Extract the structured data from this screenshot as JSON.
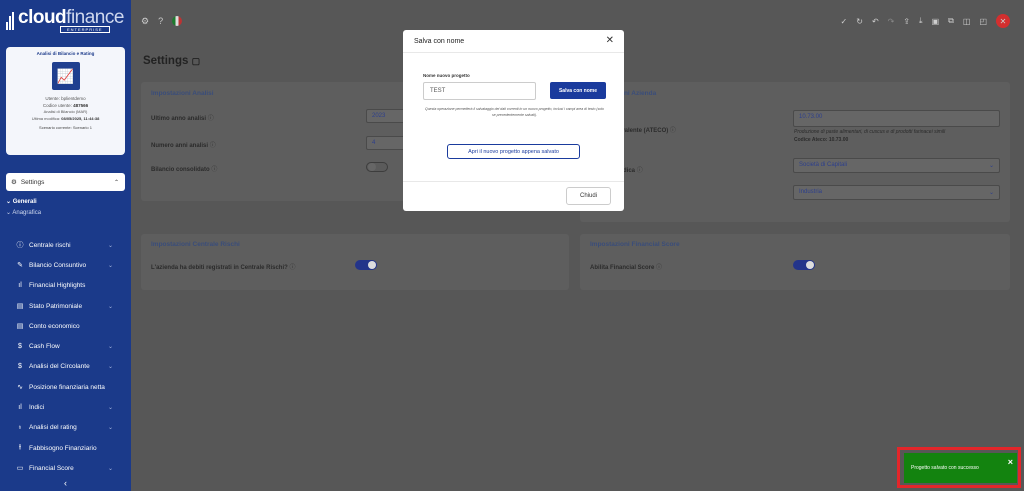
{
  "brand": {
    "logo_a": "cloud",
    "logo_b": "finance",
    "edition": "ENTERPRISE"
  },
  "card": {
    "title": "Analisi di Bilancio e Rating",
    "user_label": "Utente:",
    "user": "bplientdemo",
    "code_label": "Codice utente:",
    "code": "487566",
    "type": "Analisi di Bilancio (MAR)",
    "modified_label": "Ultima modifica:",
    "modified": "08/05/2025, 11:44:38",
    "scenario": "Scenario corrente: Scenario 1"
  },
  "nav": {
    "settings": "Settings",
    "sub": [
      "Generali",
      "Anagrafica"
    ],
    "items": [
      {
        "label": "Centrale rischi",
        "icon": "info-icon",
        "chev": true,
        "ch": "ⓘ"
      },
      {
        "label": "Bilancio Consuntivo",
        "icon": "edit-icon",
        "chev": true,
        "ch": "✎"
      },
      {
        "label": "Financial Highlights",
        "icon": "bars-icon",
        "chev": false,
        "ch": "ıl"
      },
      {
        "label": "Stato Patrimoniale",
        "icon": "document-icon",
        "chev": true,
        "ch": "▤"
      },
      {
        "label": "Conto economico",
        "icon": "document-icon",
        "chev": false,
        "ch": "▤"
      },
      {
        "label": "Cash Flow",
        "icon": "dollar-icon",
        "chev": true,
        "ch": "$"
      },
      {
        "label": "Analisi del Circolante",
        "icon": "dollar-icon",
        "chev": true,
        "ch": "$"
      },
      {
        "label": "Posizione finanziaria netta",
        "icon": "activity-icon",
        "chev": false,
        "ch": "∿"
      },
      {
        "label": "Indici",
        "icon": "bars-icon",
        "chev": true,
        "ch": "ıl"
      },
      {
        "label": "Analisi del rating",
        "icon": "medal-icon",
        "chev": true,
        "ch": "♁"
      },
      {
        "label": "Fabbisogno Finanziario",
        "icon": "sliders-icon",
        "chev": false,
        "ch": "⫲"
      },
      {
        "label": "Financial Score",
        "icon": "chat-icon",
        "chev": true,
        "ch": "▭"
      }
    ]
  },
  "page": {
    "title": "Settings"
  },
  "analisi": {
    "title": "Impostazioni Analisi",
    "ultimo_label": "Ultimo anno analisi",
    "ultimo": "2023",
    "numero_label": "Numero anni analisi",
    "numero": "4",
    "consolidato_label": "Bilancio consolidato"
  },
  "azienda": {
    "title": "Impostazioni Azienda",
    "ateco_label": "Attività prevalente (ATECO)",
    "ateco": "10.73.00",
    "ateco_desc": "Produzione di paste alimentari, di cuscus e di prodotti farinacei simili",
    "ateco_code": "Codice Ateco: 10.73.00",
    "forma_label": "Forma giuridica",
    "forma": "Società di Capitali",
    "settore": "Industria"
  },
  "rischi": {
    "title": "Impostazioni Centrale Rischi",
    "q": "L'azienda ha debiti registrati in Centrale Rischi?"
  },
  "score": {
    "title": "Impostazioni Financial Score",
    "q": "Abilita Financial Score"
  },
  "modal": {
    "title": "Salva con nome",
    "label": "Nome nuovo progetto",
    "value": "TEST",
    "save": "Salva con nome",
    "note": "Questa operazione permetterà il salvataggio dei dati correnti in un nuovo progetto, inclusi i campi area di testo (solo se precedentemente salvati).",
    "open": "Apri il nuovo progetto appena salvato",
    "close": "Chiudi"
  },
  "toast": {
    "text": "Progetto salvato con successo"
  }
}
